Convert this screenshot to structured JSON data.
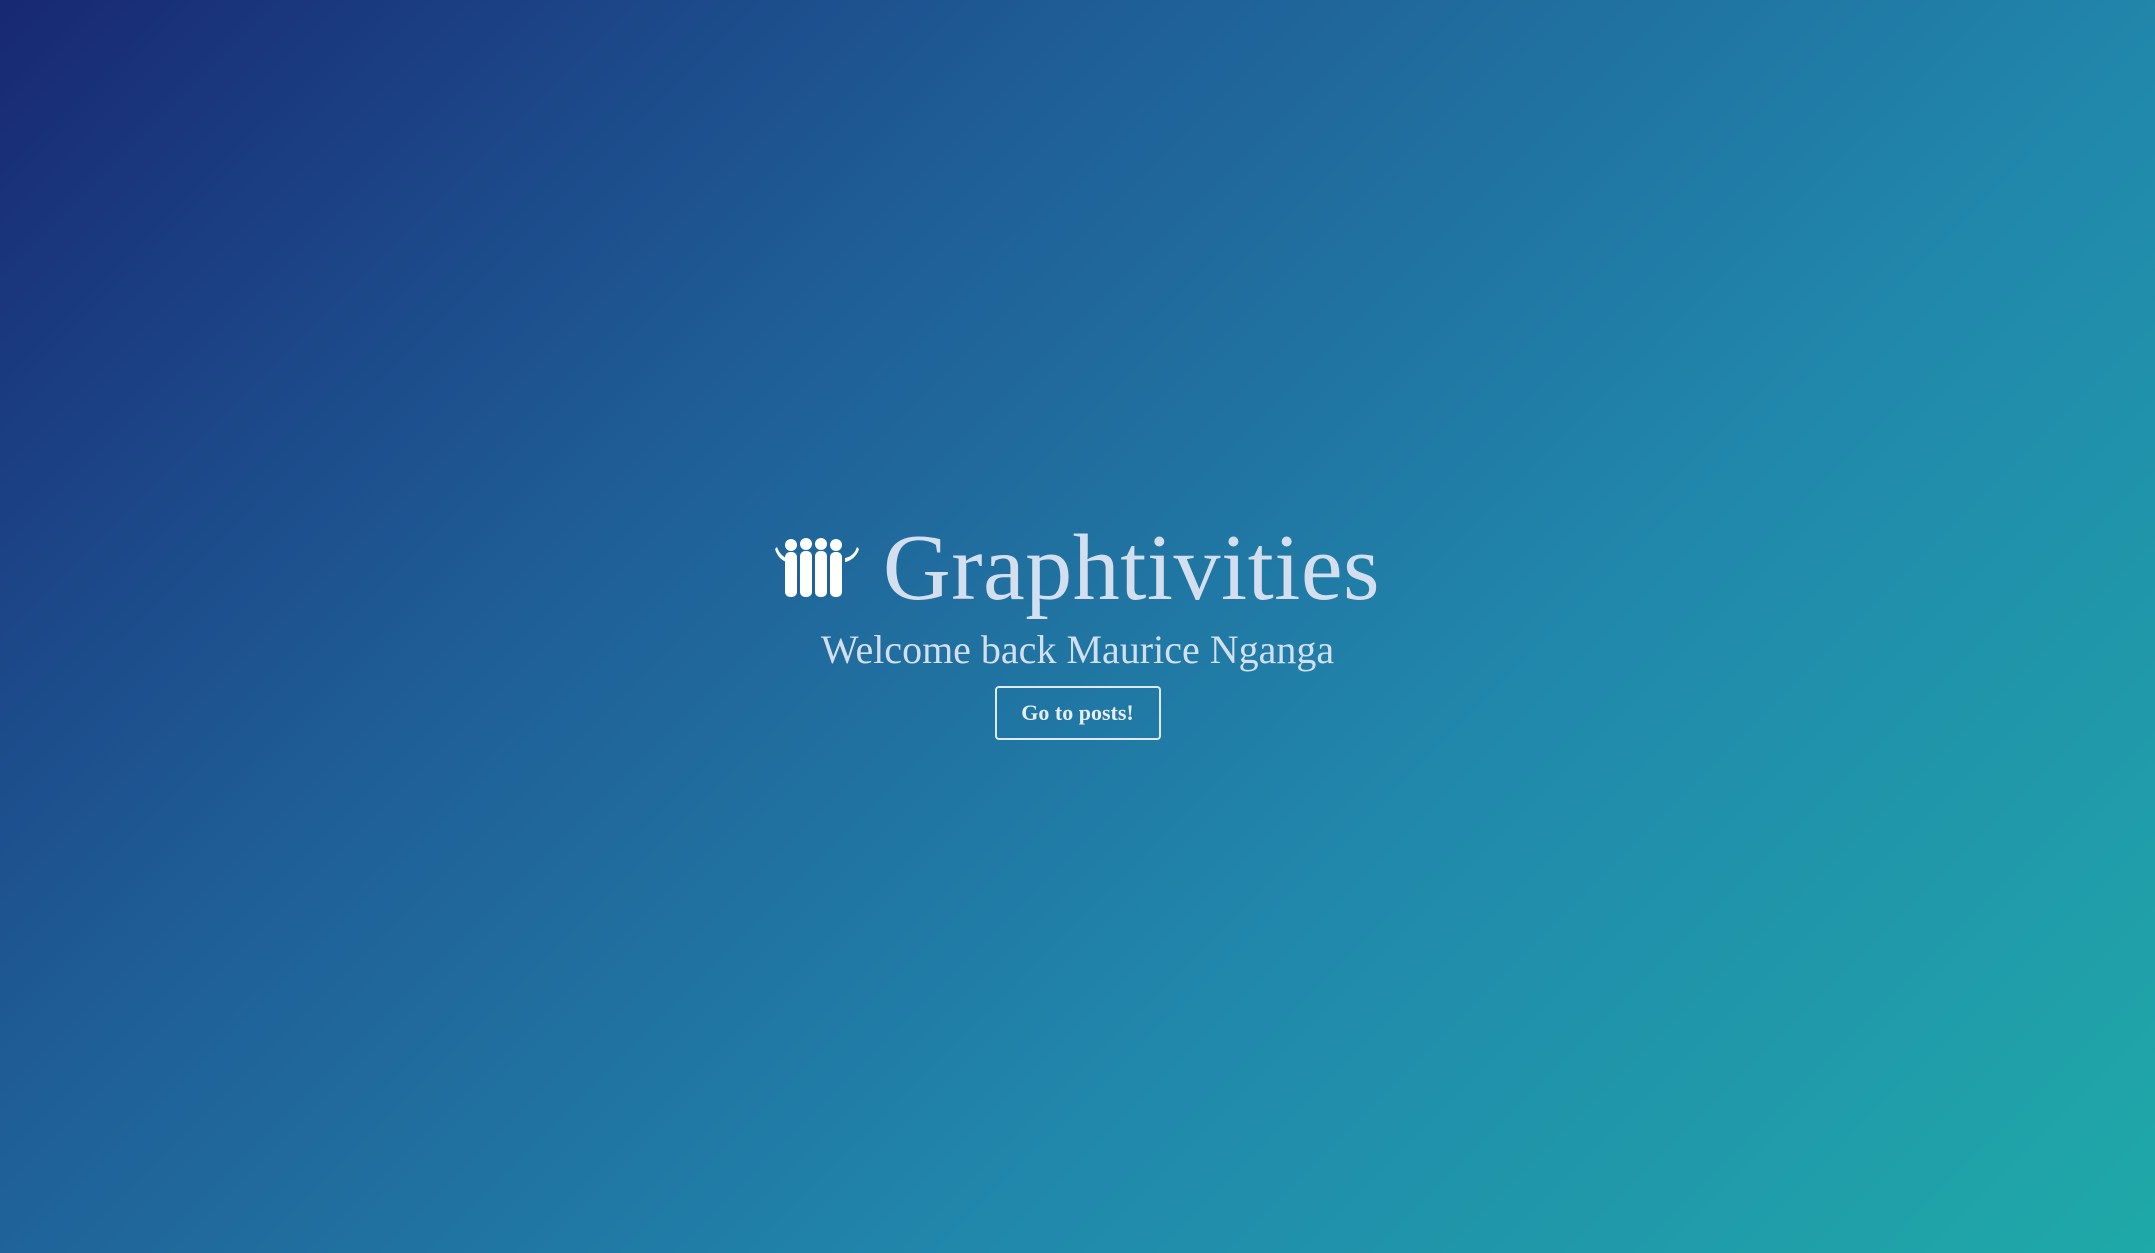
{
  "brand": {
    "title": "Graphtivities",
    "icon": "people-group-icon"
  },
  "welcome": {
    "text": "Welcome back Maurice Nganga"
  },
  "cta": {
    "label": "Go to posts!"
  },
  "colors": {
    "gradient_start": "#182873",
    "gradient_mid": "#2189ac",
    "gradient_end": "#1fa9a8",
    "text": "#d3deef"
  }
}
